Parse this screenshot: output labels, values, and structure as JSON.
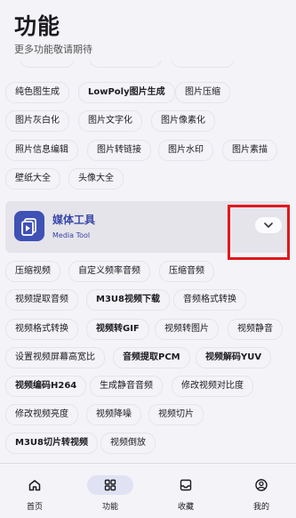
{
  "header": {
    "title": "功能",
    "subtitle": "更多功能敬请期待"
  },
  "image_tools": {
    "row1": [
      "纯色图生成",
      "LowPoly图片生成",
      "图片压缩"
    ],
    "row2": [
      "图片灰白化",
      "图片文字化",
      "图片像素化"
    ],
    "row3": [
      "照片信息编辑",
      "图片转链接",
      "图片水印",
      "图片素描"
    ],
    "row4": [
      "壁纸大全",
      "头像大全"
    ]
  },
  "media_card": {
    "title": "媒体工具",
    "subtitle": "Media Tool",
    "icon": "video-play-icon",
    "accent": "#3f51b5"
  },
  "media_tools": {
    "row1": [
      "压缩视频",
      "自定义频率音频",
      "压缩音频"
    ],
    "row2": [
      "视频提取音频",
      "M3U8视频下载",
      "音频格式转换"
    ],
    "row3": [
      "视频格式转换",
      "视频转GIF",
      "视频转图片",
      "视频静音"
    ],
    "row4": [
      "设置视频屏幕高宽比",
      "音频提取PCM",
      "视频解码YUV"
    ],
    "row5": [
      "视频编码H264",
      "生成静音音频",
      "修改视频对比度"
    ],
    "row6": [
      "修改视频亮度",
      "视频降噪",
      "视频切片"
    ],
    "row7": [
      "M3U8切片转视频",
      "视频倒放"
    ]
  },
  "nav": {
    "items": [
      {
        "label": "首页",
        "icon": "home-icon",
        "active": false
      },
      {
        "label": "功能",
        "icon": "grid-icon",
        "active": true
      },
      {
        "label": "收藏",
        "icon": "inbox-icon",
        "active": false
      },
      {
        "label": "我的",
        "icon": "profile-icon",
        "active": false
      }
    ]
  },
  "colors": {
    "highlight": "#e0181d",
    "active_pill": "#e0e2f4",
    "brand": "#3f51b5"
  }
}
